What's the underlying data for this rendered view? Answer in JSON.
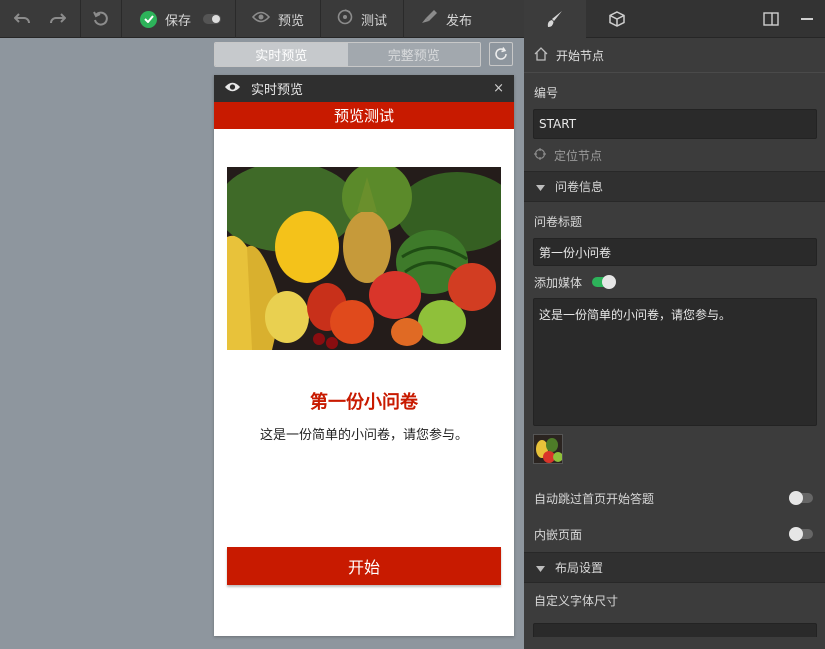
{
  "toolbar": {
    "undo_icon": "undo-icon",
    "redo_icon": "redo-icon",
    "restore_icon": "restore-icon",
    "save_label": "保存",
    "preview_label": "预览",
    "test_label": "测试",
    "publish_label": "发布",
    "save_color": "#2db35a"
  },
  "preview_tabs": {
    "live": "实时预览",
    "full": "完整预览"
  },
  "phone": {
    "header_label": "实时预览",
    "close": "×",
    "title": "预览测试",
    "survey_title": "第一份小问卷",
    "survey_desc": "这是一份简单的小问卷，请您参与。",
    "start_label": "开始",
    "accent": "#c81a00"
  },
  "panel": {
    "node_label": "开始节点",
    "id_label": "编号",
    "id_value": "START",
    "locate_label": "定位节点",
    "survey_section": "问卷信息",
    "survey_title_label": "问卷标题",
    "survey_title_value": "第一份小问卷",
    "add_media_label": "添加媒体",
    "add_media_on": true,
    "desc_value": "这是一份简单的小问卷，请您参与。",
    "auto_skip_label": "自动跳过首页开始答题",
    "auto_skip_on": false,
    "embed_label": "内嵌页面",
    "embed_on": false,
    "layout_section": "布局设置",
    "font_size_label": "自定义字体尺寸"
  }
}
